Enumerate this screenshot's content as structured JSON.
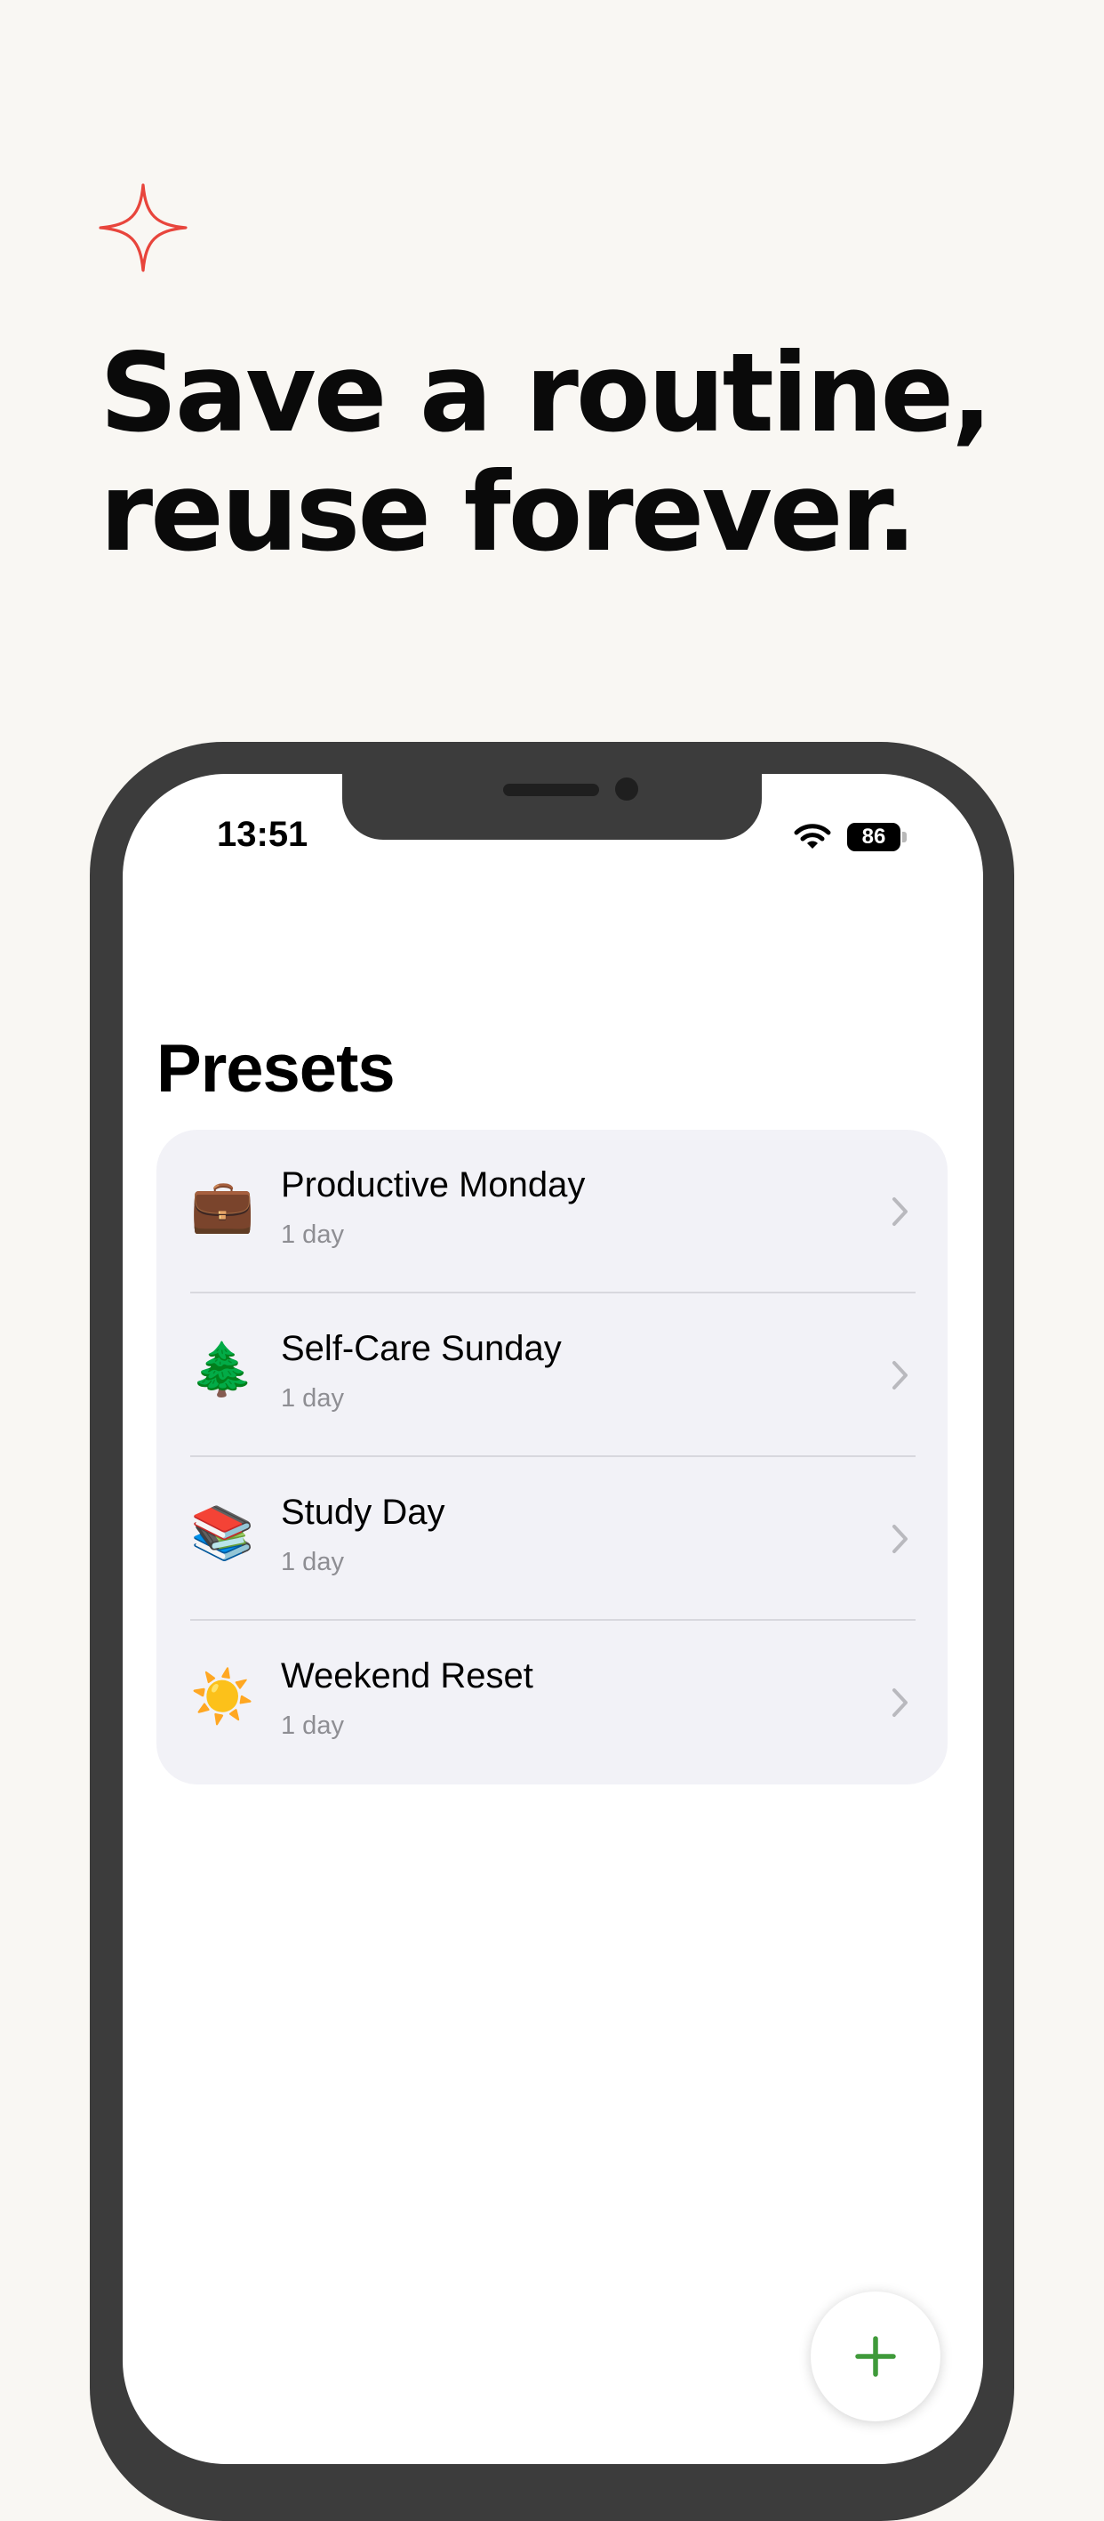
{
  "headline": {
    "line1": "Save a routine,",
    "line2": "reuse forever.",
    "accent_color": "#e8453c"
  },
  "status_bar": {
    "time": "13:51",
    "battery_level": "86"
  },
  "screen": {
    "title": "Presets"
  },
  "presets": [
    {
      "emoji": "💼",
      "icon": "briefcase-icon",
      "name": "Productive Monday",
      "duration": "1 day"
    },
    {
      "emoji": "🌲",
      "icon": "evergreen-tree-icon",
      "name": "Self-Care Sunday",
      "duration": "1 day"
    },
    {
      "emoji": "📚",
      "icon": "books-icon",
      "name": "Study Day",
      "duration": "1 day"
    },
    {
      "emoji": "☀️",
      "icon": "sun-icon",
      "name": "Weekend Reset",
      "duration": "1 day"
    }
  ],
  "fab": {
    "icon": "plus-icon",
    "color": "#3f9a3a"
  }
}
